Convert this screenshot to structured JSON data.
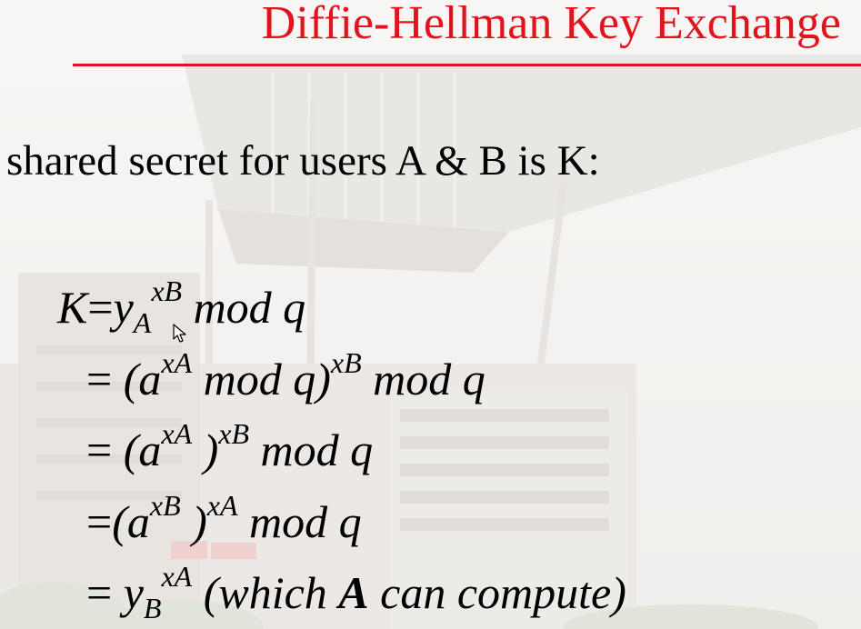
{
  "slide": {
    "title": "Diffie-Hellman Key Exchange",
    "lead_text": "shared secret for users A & B is K:",
    "colors": {
      "title": "#e0141c",
      "rule": "#e0141c",
      "text": "#000000"
    }
  },
  "equations": {
    "eq1": {
      "k": "K",
      "eqs": "=",
      "y": "y",
      "y_sub": "A",
      "exp": "x",
      "exp_sub": "B",
      "mod": "mod q"
    },
    "eq2": {
      "eqs": "=",
      "lparen": "(",
      "a": "a",
      "exp1": "x",
      "exp1_sub": "A",
      "mod_inner": "mod q",
      "rparen": ")",
      "exp2": "x",
      "exp2_sub": "B",
      "mod": "mod q"
    },
    "eq3": {
      "eqs": "=",
      "lparen": "(",
      "a": "a",
      "exp1": "x",
      "exp1_sub": "A",
      "rparen": ")",
      "exp2": "x",
      "exp2_sub": "B",
      "mod": "mod q"
    },
    "eq4": {
      "eqs": "=",
      "lparen": "(",
      "a": "a",
      "exp1": "x",
      "exp1_sub": "B",
      "rparen": ")",
      "exp2": "x",
      "exp2_sub": "A",
      "mod": "mod q"
    },
    "eq5": {
      "eqs": "=",
      "y": "y",
      "y_sub": "B",
      "exp": "x",
      "exp_sub": "A",
      "paren_open": "(which",
      "bold_a": "A",
      "paren_close": "can compute)"
    }
  },
  "icons": {
    "cursor": "mouse-pointer-icon"
  }
}
